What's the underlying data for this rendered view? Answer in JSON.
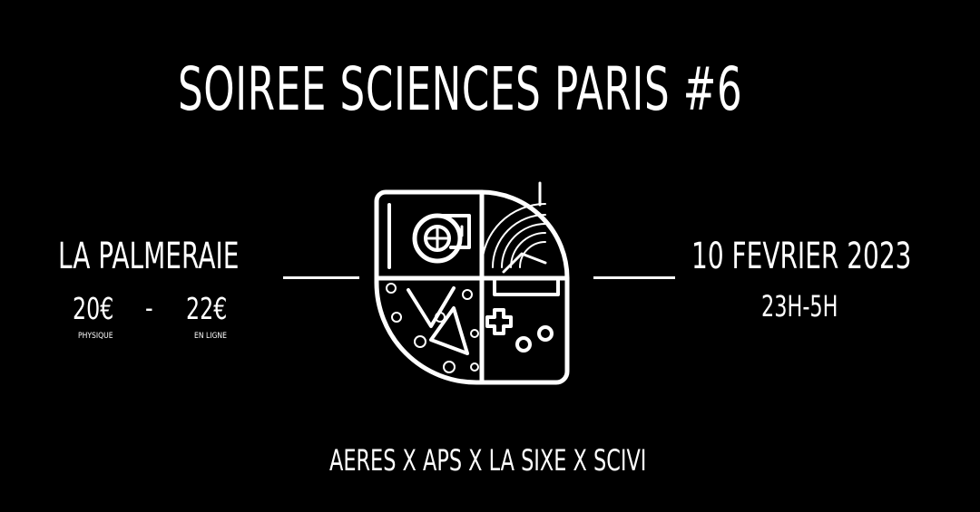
{
  "event": {
    "title": "SOIREE SCIENCES PARIS #6",
    "venue": "LA PALMERAIE",
    "price_physical": "20€",
    "price_separator": "-",
    "price_online": "22€",
    "label_physical": "PHYSIQUE",
    "label_online": "EN LIGNE",
    "date": "10 FEVRIER 2023",
    "time": "23H-5H",
    "partners": "AERES X APS X LA SIXE X SCIVI"
  },
  "colors": {
    "background": "#000000",
    "foreground": "#ffffff"
  },
  "logo": {
    "icon": "science-night-emblem-icon"
  }
}
